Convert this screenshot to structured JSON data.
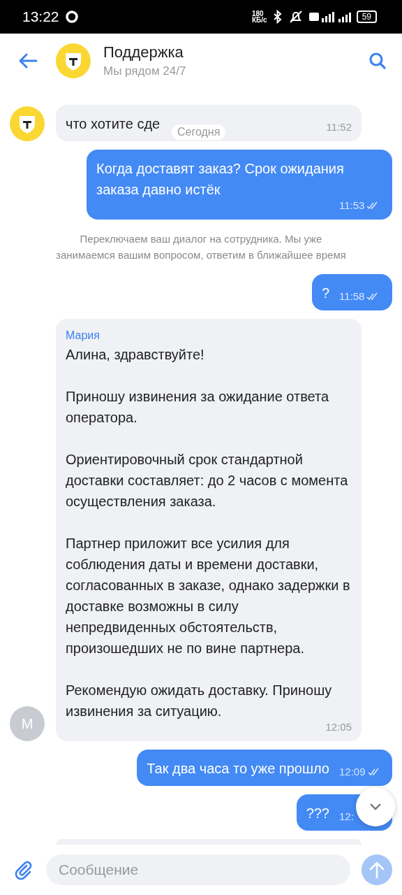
{
  "status_bar": {
    "time": "13:22",
    "speed_value": "180",
    "speed_unit": "КБ/с",
    "battery": "59"
  },
  "header": {
    "title": "Поддержка",
    "subtitle": "Мы рядом 24/7"
  },
  "date_pill": "Сегодня",
  "messages": [
    {
      "kind": "incoming",
      "avatar": {
        "kind": "logo"
      },
      "paragraphs": [
        "что хотите сде"
      ],
      "time": "11:52"
    },
    {
      "kind": "outgoing",
      "paragraphs": [
        "Когда доставят заказ? Срок ожидания заказа давно истёк"
      ],
      "time": "11:53",
      "read": true
    },
    {
      "kind": "system",
      "paragraphs": [
        "Переключаем ваш диалог на сотрудника. Мы уже занимаемся вашим вопросом, ответим в ближайшее время"
      ]
    },
    {
      "kind": "outgoing",
      "paragraphs": [
        "?"
      ],
      "time": "11:58",
      "read": true
    },
    {
      "kind": "incoming",
      "avatar": {
        "kind": "letter",
        "letter": "М"
      },
      "sender": "Мария",
      "paragraphs": [
        "Алина, здравствуйте!",
        "Приношу извинения за ожидание ответа оператора.",
        "Ориентировочный срок стандартной доставки составляет: до 2 часов с момента осуществления заказа.",
        "Партнер приложит все усилия для соблюдения даты и времени доставки, согласованных в заказе, однако задержки в доставке возможны в силу непредвиденных обстоятельств, произошедших не по вине партнера.",
        "Рекомендую ожидать доставку. Приношу извинения за ситуацию."
      ],
      "time": "12:05"
    },
    {
      "kind": "outgoing",
      "paragraphs": [
        "Так два часа то уже прошло"
      ],
      "time": "12:09",
      "read": true
    },
    {
      "kind": "outgoing",
      "paragraphs": [
        "???"
      ],
      "time": "12:"
    }
  ],
  "composer": {
    "placeholder": "Сообщение"
  }
}
